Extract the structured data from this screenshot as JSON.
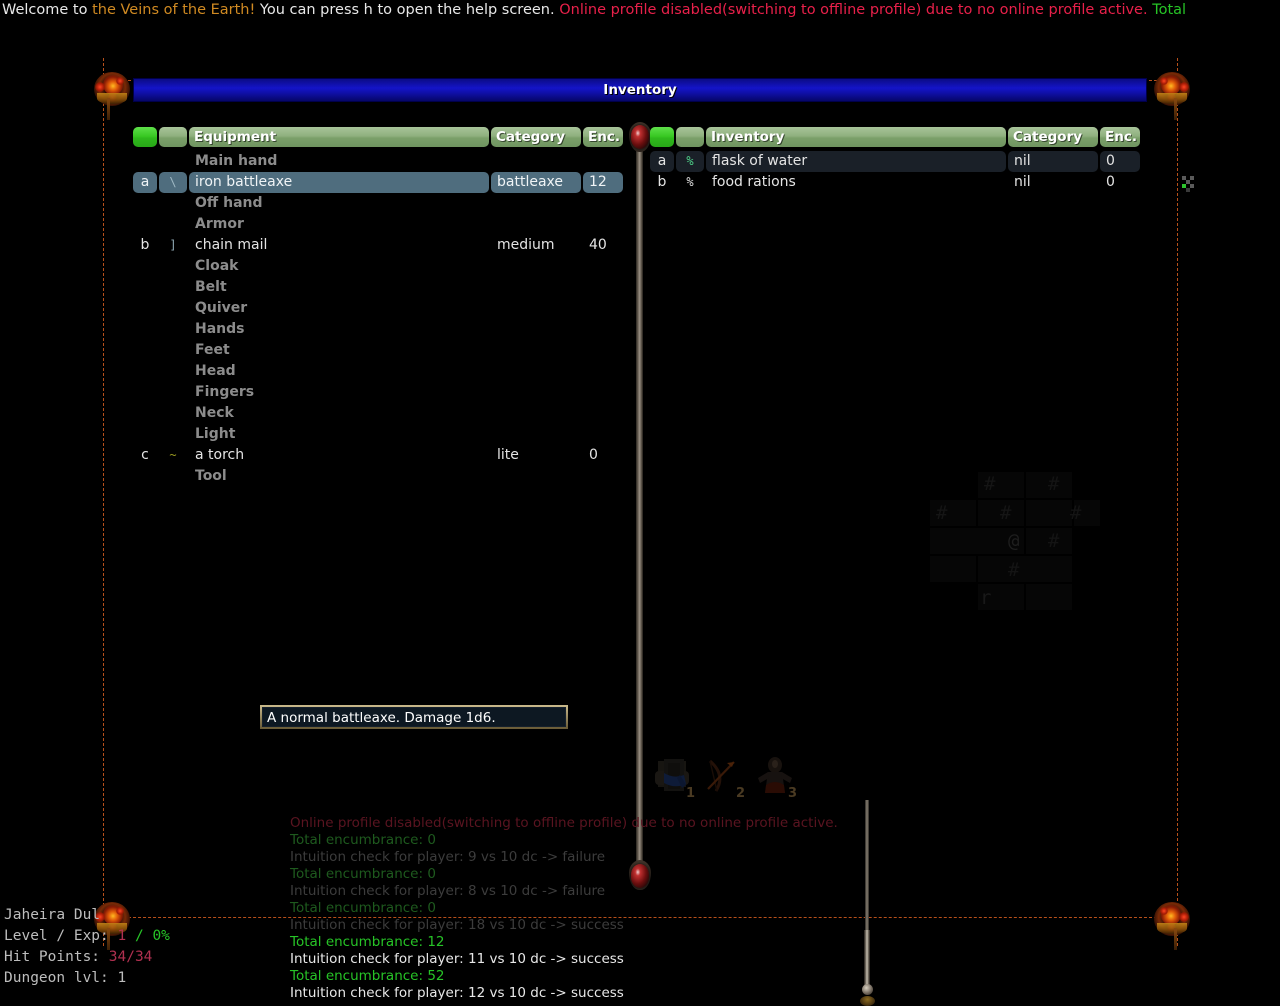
{
  "top_message": {
    "segments": [
      {
        "text": "Welcome to ",
        "color": "#e8e8e8"
      },
      {
        "text": "the Veins of the Earth!",
        "color": "#d08a22"
      },
      {
        "text": " You can press h to open the help screen. ",
        "color": "#e8e8e8"
      },
      {
        "text": "Online profile disabled(switching to offline profile) due to no online profile active.",
        "color": "#e8204a"
      },
      {
        "text": " Total",
        "color": "#26c426"
      }
    ]
  },
  "window": {
    "title": "Inventory"
  },
  "equipment_panel": {
    "columns": [
      "",
      "",
      "Equipment",
      "Category",
      "Enc."
    ],
    "rows": [
      {
        "kind": "slot",
        "letter": "",
        "sym": "",
        "name": "Main hand",
        "category": "",
        "enc": ""
      },
      {
        "kind": "item",
        "letter": "a",
        "sym": "\\",
        "name": "iron battleaxe",
        "category": "battleaxe",
        "enc": "12",
        "selected": true
      },
      {
        "kind": "slot",
        "letter": "",
        "sym": "",
        "name": "Off hand",
        "category": "",
        "enc": ""
      },
      {
        "kind": "slot",
        "letter": "",
        "sym": "",
        "name": "Armor",
        "category": "",
        "enc": ""
      },
      {
        "kind": "item",
        "letter": "b",
        "sym": "]",
        "name": "chain mail",
        "category": "medium",
        "enc": "40",
        "selected": false
      },
      {
        "kind": "slot",
        "letter": "",
        "sym": "",
        "name": "Cloak",
        "category": "",
        "enc": ""
      },
      {
        "kind": "slot",
        "letter": "",
        "sym": "",
        "name": "Belt",
        "category": "",
        "enc": ""
      },
      {
        "kind": "slot",
        "letter": "",
        "sym": "",
        "name": "Quiver",
        "category": "",
        "enc": ""
      },
      {
        "kind": "slot",
        "letter": "",
        "sym": "",
        "name": "Hands",
        "category": "",
        "enc": ""
      },
      {
        "kind": "slot",
        "letter": "",
        "sym": "",
        "name": "Feet",
        "category": "",
        "enc": ""
      },
      {
        "kind": "slot",
        "letter": "",
        "sym": "",
        "name": "Head",
        "category": "",
        "enc": ""
      },
      {
        "kind": "slot",
        "letter": "",
        "sym": "",
        "name": "Fingers",
        "category": "",
        "enc": ""
      },
      {
        "kind": "slot",
        "letter": "",
        "sym": "",
        "name": "Neck",
        "category": "",
        "enc": ""
      },
      {
        "kind": "slot",
        "letter": "",
        "sym": "",
        "name": "Light",
        "category": "",
        "enc": ""
      },
      {
        "kind": "item",
        "letter": "c",
        "sym": "~",
        "name": "a torch",
        "category": "lite",
        "enc": "0",
        "selected": false
      },
      {
        "kind": "slot",
        "letter": "",
        "sym": "",
        "name": "Tool",
        "category": "",
        "enc": ""
      }
    ]
  },
  "inventory_panel": {
    "columns": [
      "",
      "",
      "Inventory",
      "Category",
      "Enc."
    ],
    "rows": [
      {
        "letter": "a",
        "sym": "%",
        "name": "flask of water",
        "category": "nil",
        "enc": "0",
        "cursor": true
      },
      {
        "letter": "b",
        "sym": "%",
        "name": "food rations",
        "category": "nil",
        "enc": "0",
        "cursor": false
      }
    ]
  },
  "tooltip": {
    "text": "A normal battleaxe. Damage 1d6."
  },
  "hotbar": [
    {
      "num": "1",
      "icon": "scroll-icon"
    },
    {
      "num": "2",
      "icon": "bow-icon"
    },
    {
      "num": "3",
      "icon": "figure-icon"
    }
  ],
  "map": {
    "player_glyph": "@",
    "wall_glyph": "#",
    "creature_glyph": "r"
  },
  "log": [
    {
      "text": "Online profile disabled(switching to offline profile) due to no online profile active.",
      "color": "#5a1420"
    },
    {
      "text": "Total encumbrance: 0",
      "color": "#1e5a1e"
    },
    {
      "text": "Intuition check for player: 9 vs 10 dc -> failure",
      "color": "#3c3c3c"
    },
    {
      "text": "Total encumbrance: 0",
      "color": "#1e5a1e"
    },
    {
      "text": "Intuition check for player: 8 vs 10 dc -> failure",
      "color": "#3c3c3c"
    },
    {
      "text": "Total encumbrance: 0",
      "color": "#1e5a1e"
    },
    {
      "text": "Intuition check for player: 18 vs 10 dc -> success",
      "color": "#3c3c3c"
    },
    {
      "text": "Total encumbrance: 12",
      "color": "#27c427"
    },
    {
      "text": "Intuition check for player: 11 vs 10 dc -> success",
      "color": "#e8e8e8"
    },
    {
      "text": "Total encumbrance: 52",
      "color": "#27c427"
    },
    {
      "text": "Intuition check for player: 12 vs 10 dc -> success",
      "color": "#e8e8e8"
    }
  ],
  "status": {
    "name_label": "Jaheira Dul",
    "level_label": "Level / Exp: ",
    "level_value": "1",
    "level_sep": " / ",
    "exp_value": "0%",
    "hp_label": "Hit Points: ",
    "hp_value": "34/34",
    "dungeon_label": "Dungeon lvl: ",
    "dungeon_value": "1"
  },
  "colors": {
    "header_green": "#8fb07e",
    "header_active_green": "#37c722",
    "selected_row": "#4f6d7e",
    "titlebar_blue": "#1414c8",
    "frame_dash": "#b8501a"
  }
}
